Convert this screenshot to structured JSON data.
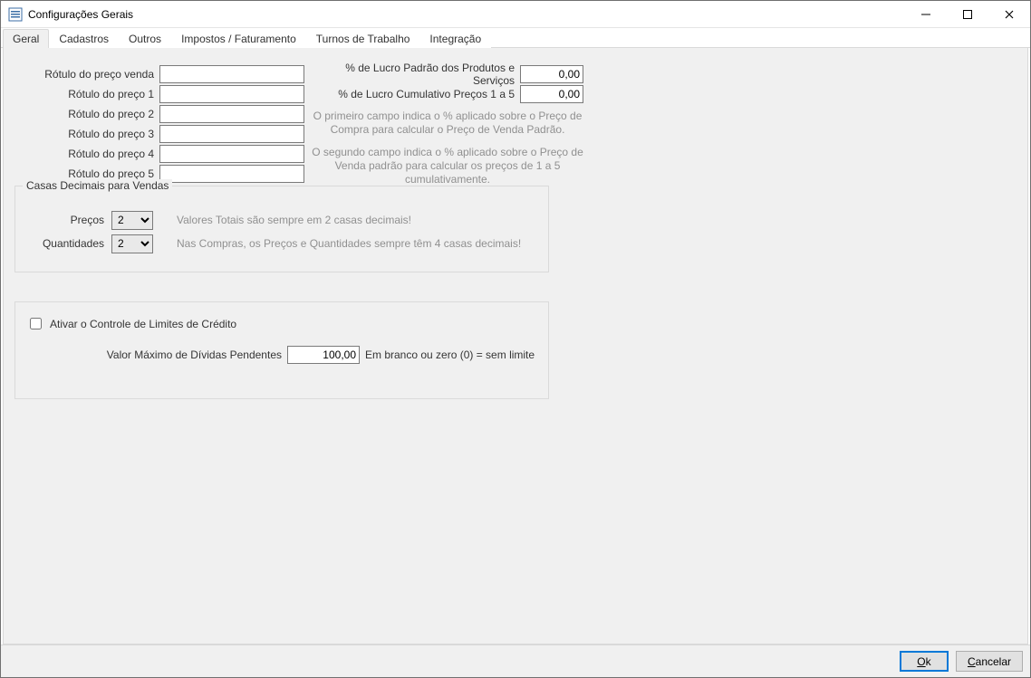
{
  "window": {
    "title": "Configurações Gerais"
  },
  "tabs": [
    "Geral",
    "Cadastros",
    "Outros",
    "Impostos / Faturamento",
    "Turnos de Trabalho",
    "Integração"
  ],
  "active_tab_index": 0,
  "labels": {
    "rotulo_venda": "Rótulo do preço venda",
    "rotulo_1": "Rótulo do preço 1",
    "rotulo_2": "Rótulo do preço 2",
    "rotulo_3": "Rótulo do preço 3",
    "rotulo_4": "Rótulo do preço 4",
    "rotulo_5": "Rótulo do preço 5",
    "lucro_padrao": "% de Lucro Padrão dos Produtos e Serviços",
    "lucro_cumulativo": "% de Lucro Cumulativo Preços 1 a 5",
    "help1": "O primeiro campo indica o % aplicado sobre o Preço de Compra para calcular o Preço de Venda Padrão.",
    "help2": "O segundo campo indica o % aplicado sobre o Preço de Venda padrão para calcular os preços de 1 a 5 cumulativamente.",
    "grp_decimals": "Casas Decimais para Vendas",
    "dec_precos": "Preços",
    "dec_qtd": "Quantidades",
    "dec_note1": "Valores Totais são sempre em 2 casas decimais!",
    "dec_note2": "Nas Compras, os Preços e Quantidades sempre têm 4 casas decimais!",
    "chk_credit": "Ativar o Controle de Limites de Crédito",
    "max_dividas": "Valor Máximo de Dívidas Pendentes",
    "max_dividas_hint": "Em branco ou zero (0) = sem limite"
  },
  "values": {
    "rotulo_venda": "",
    "rotulo_1": "",
    "rotulo_2": "",
    "rotulo_3": "",
    "rotulo_4": "",
    "rotulo_5": "",
    "lucro_padrao": "0,00",
    "lucro_cumulativo": "0,00",
    "dec_precos": "2",
    "dec_qtd": "2",
    "ativar_credito": false,
    "max_dividas": "100,00"
  },
  "buttons": {
    "ok_prefix": "O",
    "ok_rest": "k",
    "cancel_prefix": "C",
    "cancel_rest": "ancelar"
  }
}
